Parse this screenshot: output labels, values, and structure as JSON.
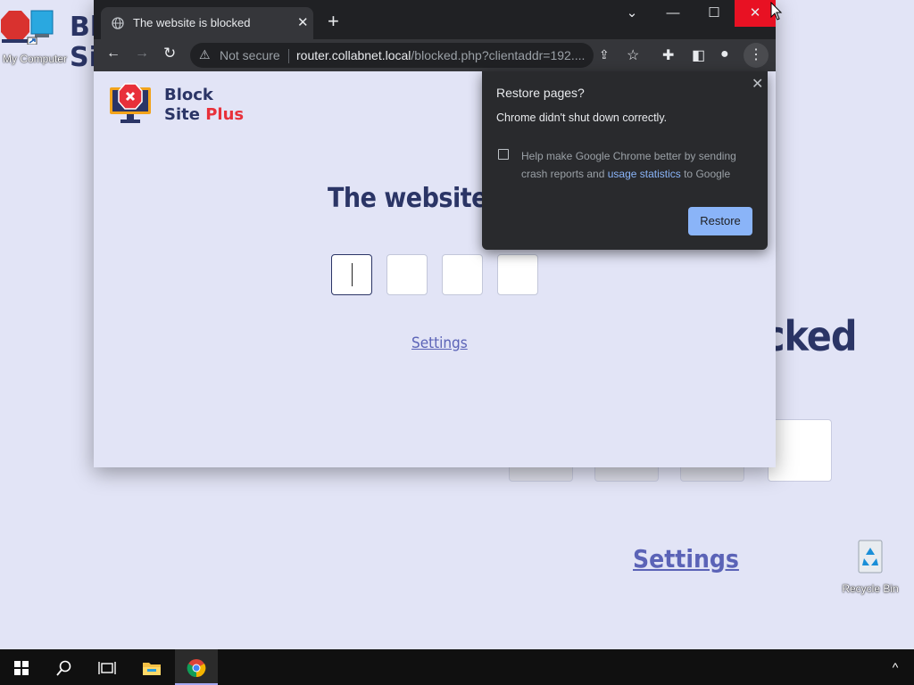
{
  "desktop": {
    "icons": [
      {
        "label": "My Computer"
      },
      {
        "label": "Recycle Bin"
      }
    ],
    "background_page": {
      "logo_text_line1": "Bl",
      "logo_text_line2": "Si",
      "heading_fragment": "cked",
      "settings_label": "Settings"
    }
  },
  "browser": {
    "tab": {
      "title": "The website is blocked"
    },
    "window_controls": {
      "dropdown": "⌄",
      "minimize": "—",
      "maximize": "☐",
      "close": "✕"
    },
    "address_bar": {
      "security_label": "Not secure",
      "url_host": "router.collabnet.local",
      "url_path": "/blocked.php?clientaddr=192...."
    },
    "colors": {
      "titlebar": "#202124",
      "toolbar": "#35363a",
      "close_hover": "#e81123"
    }
  },
  "page": {
    "logo": {
      "line1": "Block",
      "line2_a": "Site ",
      "line2_b": "Plus"
    },
    "heading": "The website is bl",
    "pin_boxes": 4,
    "settings_link": "Settings",
    "colors": {
      "heading": "#2b3566",
      "accent": "#e8303a",
      "link": "#5b63b7",
      "background": "#e2e4f6"
    }
  },
  "restore_dialog": {
    "title": "Restore pages?",
    "subtitle": "Chrome didn't shut down correctly.",
    "checkbox_text_before": "Help make Google Chrome better by sending crash reports and ",
    "checkbox_link": "usage statistics",
    "checkbox_text_after": " to Google",
    "checkbox_checked": false,
    "restore_button": "Restore",
    "colors": {
      "background": "#292a2d",
      "button": "#8ab4f8"
    }
  },
  "taskbar": {
    "items": [
      "start-icon",
      "search-icon",
      "task-view-icon",
      "file-explorer-icon",
      "chrome-icon"
    ],
    "tray": "^"
  }
}
